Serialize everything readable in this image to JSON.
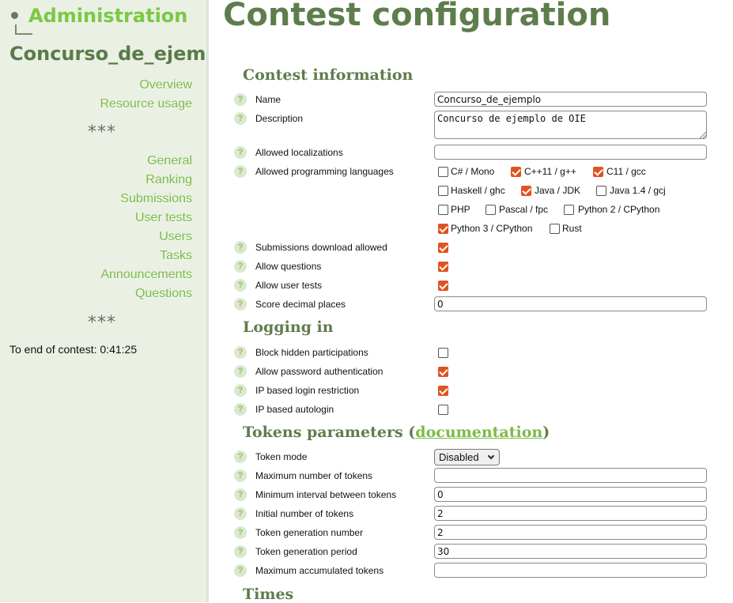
{
  "sidebar": {
    "admin_label": "Administration",
    "contest_name": "Concurso_de_ejem",
    "menu_top": [
      "Overview",
      "Resource usage"
    ],
    "separator": "***",
    "menu_main": [
      "General",
      "Ranking",
      "Submissions",
      "User tests",
      "Users",
      "Tasks",
      "Announcements",
      "Questions"
    ],
    "countdown": "To end of contest: 0:41:25"
  },
  "main": {
    "title": "Contest configuration",
    "help_glyph": "?",
    "sections": {
      "contest_information": "Contest information",
      "logging_in": "Logging in",
      "tokens_prefix": "Tokens parameters (",
      "tokens_link": "documentation",
      "tokens_suffix": ")",
      "times": "Times"
    },
    "fields": {
      "name": {
        "label": "Name",
        "value": "Concurso_de_ejemplo"
      },
      "description": {
        "label": "Description",
        "value": "Concurso de ejemplo de OIE"
      },
      "allowed_localizations": {
        "label": "Allowed localizations",
        "value": ""
      },
      "allowed_languages": {
        "label": "Allowed programming languages",
        "options": [
          {
            "label": "C# / Mono",
            "checked": false
          },
          {
            "label": "C++11 / g++",
            "checked": true
          },
          {
            "label": "C11 / gcc",
            "checked": true
          },
          {
            "label": "Haskell / ghc",
            "checked": false
          },
          {
            "label": "Java / JDK",
            "checked": true
          },
          {
            "label": "Java 1.4 / gcj",
            "checked": false
          },
          {
            "label": "PHP",
            "checked": false
          },
          {
            "label": "Pascal / fpc",
            "checked": false
          },
          {
            "label": "Python 2 / CPython",
            "checked": false
          },
          {
            "label": "Python 3 / CPython",
            "checked": true
          },
          {
            "label": "Rust",
            "checked": false
          }
        ]
      },
      "submissions_download_allowed": {
        "label": "Submissions download allowed",
        "checked": true
      },
      "allow_questions": {
        "label": "Allow questions",
        "checked": true
      },
      "allow_user_tests": {
        "label": "Allow user tests",
        "checked": true
      },
      "score_decimal_places": {
        "label": "Score decimal places",
        "value": "0"
      },
      "block_hidden_participations": {
        "label": "Block hidden participations",
        "checked": false
      },
      "allow_password_authentication": {
        "label": "Allow password authentication",
        "checked": true
      },
      "ip_based_login_restriction": {
        "label": "IP based login restriction",
        "checked": true
      },
      "ip_based_autologin": {
        "label": "IP based autologin",
        "checked": false
      },
      "token_mode": {
        "label": "Token mode",
        "value": "Disabled"
      },
      "max_tokens": {
        "label": "Maximum number of tokens",
        "value": ""
      },
      "min_interval": {
        "label": "Minimum interval between tokens",
        "value": "0"
      },
      "initial_tokens": {
        "label": "Initial number of tokens",
        "value": "2"
      },
      "token_gen_number": {
        "label": "Token generation number",
        "value": "2"
      },
      "token_gen_period": {
        "label": "Token generation period",
        "value": "30"
      },
      "max_accumulated": {
        "label": "Maximum accumulated tokens",
        "value": ""
      }
    }
  },
  "colors": {
    "accent_green": "#7cba46",
    "heading_green": "#5e7d4c",
    "checkbox_checked": "#e0531f",
    "sidebar_bg": "#eaf0e4"
  }
}
